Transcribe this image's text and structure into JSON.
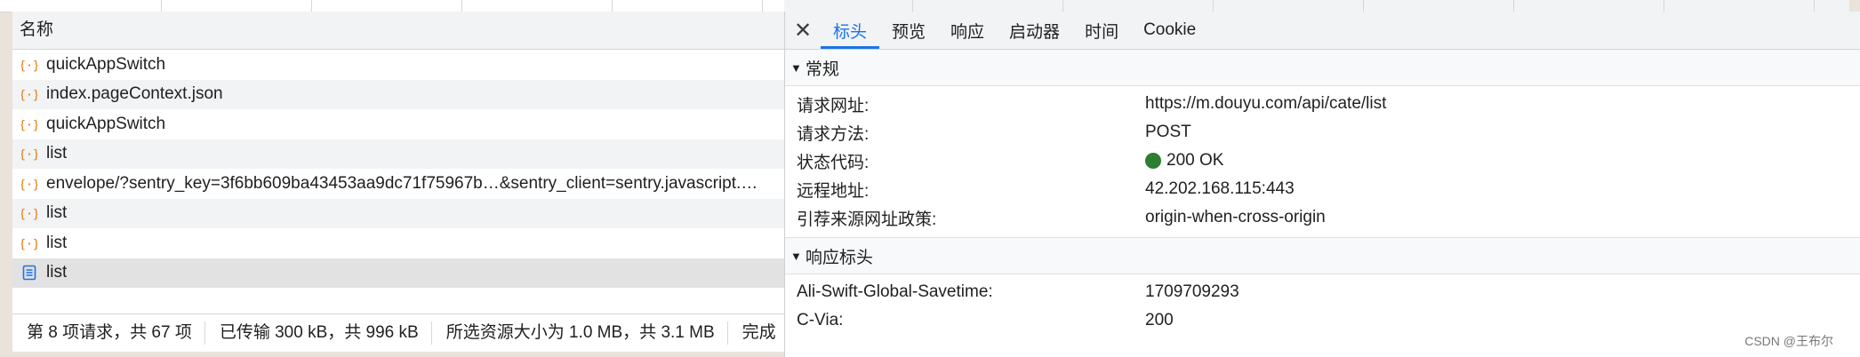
{
  "list_panel": {
    "header": "名称",
    "rows": [
      {
        "name": "quickAppSwitch",
        "icon": "json-brace-icon"
      },
      {
        "name": "index.pageContext.json",
        "icon": "json-brace-icon"
      },
      {
        "name": "quickAppSwitch",
        "icon": "json-brace-icon"
      },
      {
        "name": "list",
        "icon": "json-brace-icon"
      },
      {
        "name": "envelope/?sentry_key=3f6bb609ba43453aa9dc71f75967b…&sentry_client=sentry.javascript.…",
        "icon": "json-brace-icon"
      },
      {
        "name": "list",
        "icon": "json-brace-icon"
      },
      {
        "name": "list",
        "icon": "json-brace-icon"
      },
      {
        "name": "list",
        "icon": "document-icon"
      }
    ],
    "status": {
      "requests": "第 8 项请求，共 67 项",
      "transferred": "已传输 300 kB，共 996 kB",
      "resources": "所选资源大小为 1.0 MB，共 3.1 MB",
      "finish": "完成"
    }
  },
  "details_panel": {
    "close_icon": "close-icon",
    "tabs": [
      "标头",
      "预览",
      "响应",
      "启动器",
      "时间",
      "Cookie"
    ],
    "active_tab": "标头",
    "general": {
      "title": "常规",
      "rows": [
        {
          "key": "请求网址:",
          "value": "https://m.douyu.com/api/cate/list"
        },
        {
          "key": "请求方法:",
          "value": "POST"
        },
        {
          "key": "状态代码:",
          "value": "200 OK"
        },
        {
          "key": "远程地址:",
          "value": "42.202.168.115:443"
        },
        {
          "key": "引荐来源网址政策:",
          "value": "origin-when-cross-origin"
        }
      ]
    },
    "response_headers": {
      "title": "响应标头",
      "rows": [
        {
          "key": "Ali-Swift-Global-Savetime:",
          "value": "1709709293"
        },
        {
          "key": "C-Via:",
          "value": "200"
        }
      ]
    }
  },
  "colors": {
    "accent": "#1a73e8",
    "status_ok": "#2e7d32",
    "json_icon": "#e37400",
    "doc_icon": "#1a73e8"
  },
  "watermark": "CSDN @王布尔"
}
